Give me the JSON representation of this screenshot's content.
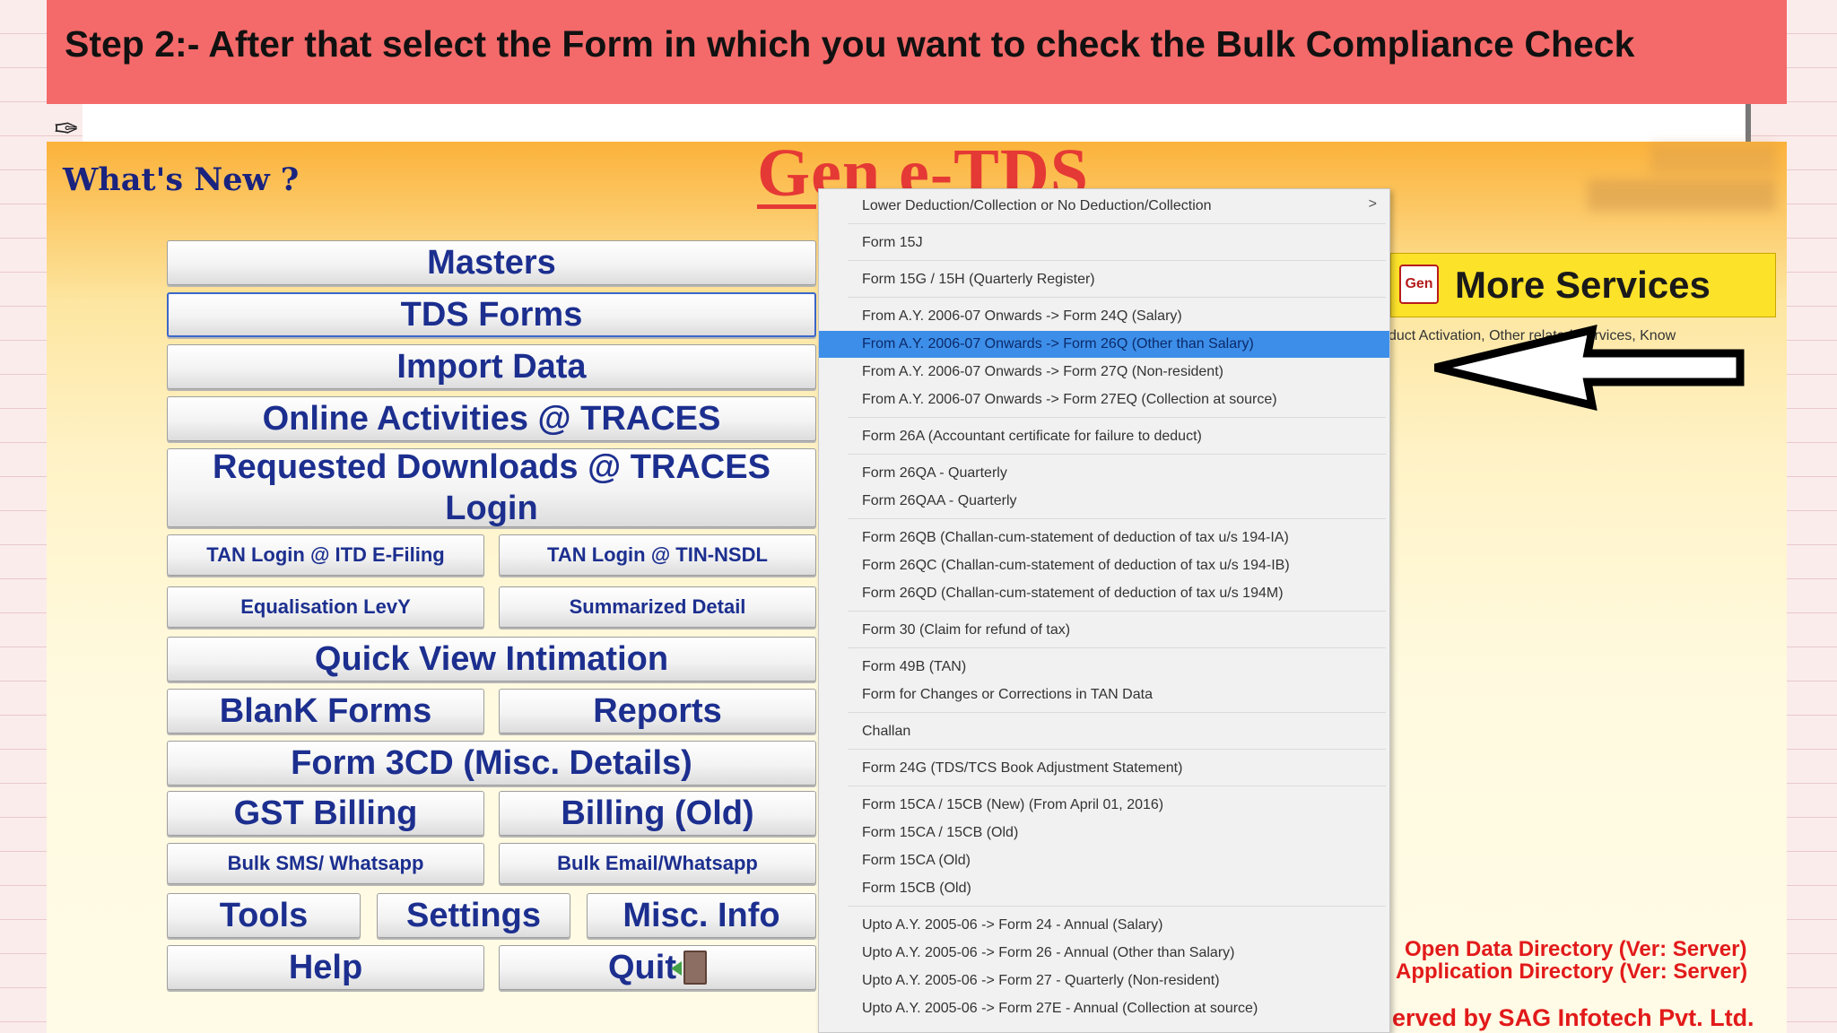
{
  "banner": {
    "text": "Step 2:- After that select the Form in which you want to check the Bulk Compliance Check"
  },
  "header": {
    "whats_new": "What's New ?",
    "logo": "Gen e-TDS"
  },
  "buttons": {
    "masters": "Masters",
    "tds_forms": "TDS Forms",
    "import_data": "Import Data",
    "online_activities": "Online Activities @ TRACES",
    "requested_downloads": "Requested Downloads @ TRACES Login",
    "tan_login_itd": "TAN Login @ ITD E-Filing",
    "tan_login_nsdl": "TAN Login @ TIN-NSDL",
    "equalisation_levy": "Equalisation LevY",
    "summarized_detail": "Summarized Detail",
    "quick_view": "Quick View Intimation",
    "blank_forms": "BlanK Forms",
    "reports": "Reports",
    "form_3cd": "Form 3CD (Misc. Details)",
    "gst_billing": "GST Billing",
    "billing_old": "Billing (Old)",
    "bulk_sms": "Bulk SMS/ Whatsapp",
    "bulk_email": "Bulk Email/Whatsapp",
    "tools": "Tools",
    "settings": "Settings",
    "misc_info": "Misc. Info",
    "help": "Help",
    "quit": "Quit"
  },
  "more_services": {
    "label": "More Services",
    "icon_text": "Gen",
    "note": "duct Activation, Other related Services, Know"
  },
  "footer": {
    "open_data_dir": "Open Data Directory (Ver: Server)",
    "app_dir": "Application Directory (Ver: Server)",
    "reserved": "erved by SAG Infotech Pvt. Ltd."
  },
  "menu": {
    "items": [
      "Lower Deduction/Collection or No Deduction/Collection",
      "Form 15J",
      "Form 15G / 15H (Quarterly Register)",
      "From A.Y. 2006-07 Onwards -> Form 24Q (Salary)",
      "From A.Y. 2006-07 Onwards -> Form 26Q (Other than Salary)",
      "From A.Y. 2006-07 Onwards -> Form 27Q (Non-resident)",
      "From A.Y. 2006-07 Onwards -> Form 27EQ (Collection at source)",
      "Form 26A (Accountant certificate for failure to deduct)",
      "Form 26QA - Quarterly",
      "Form 26QAA - Quarterly",
      "Form 26QB (Challan-cum-statement of deduction of tax u/s 194-IA)",
      "Form 26QC (Challan-cum-statement of deduction of tax u/s 194-IB)",
      "Form 26QD (Challan-cum-statement of deduction of tax u/s 194M)",
      "Form 30 (Claim for refund of tax)",
      "Form 49B (TAN)",
      "Form for Changes or Corrections in TAN Data",
      "Challan",
      "Form 24G (TDS/TCS Book Adjustment Statement)",
      "Form 15CA / 15CB (New) (From April 01, 2016)",
      "Form 15CA / 15CB (Old)",
      "Form 15CA (Old)",
      "Form 15CB (Old)",
      "Upto A.Y. 2005-06 -> Form 24 - Annual (Salary)",
      "Upto A.Y. 2005-06 -> Form 26 - Annual (Other than Salary)",
      "Upto A.Y. 2005-06 -> Form 27 - Quarterly (Non-resident)",
      "Upto A.Y. 2005-06 -> Form 27E - Annual (Collection at source)"
    ],
    "submenu_indicator": ">"
  }
}
